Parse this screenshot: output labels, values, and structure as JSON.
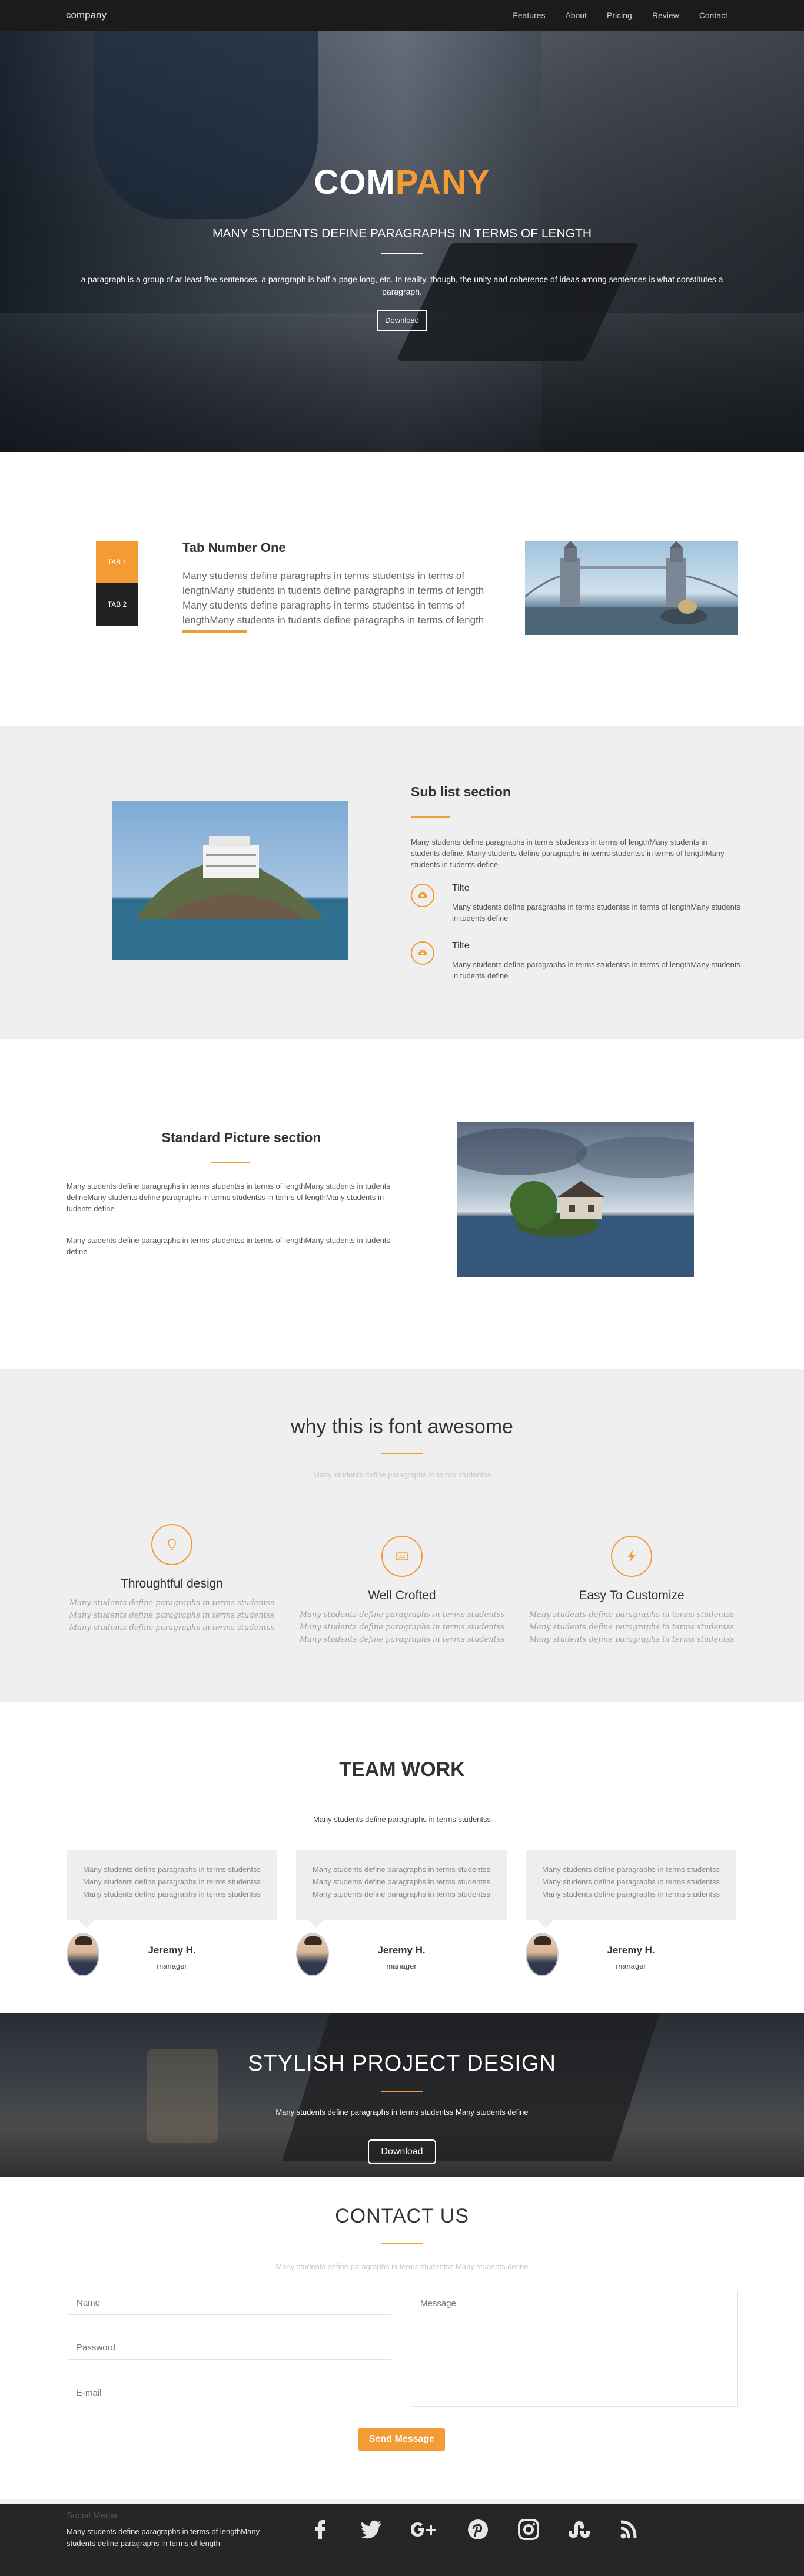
{
  "nav": {
    "brand": "company",
    "links": [
      "Features",
      "About",
      "Pricing",
      "Review",
      "Contact"
    ]
  },
  "hero": {
    "title_white": "COM",
    "title_orange": "PANY",
    "subtitle": "MANY STUDENTS DEFINE PARAGRAPHS IN TERMS OF LENGTH",
    "text": "a paragraph is a group of at least five sentences, a paragraph is half a page long, etc. In reality, though, the unity and coherence of ideas among sentences is what constitutes a paragraph.",
    "button": "Download"
  },
  "tabs": {
    "items": [
      "TAB 1",
      "TAB 2"
    ],
    "title": "Tab Number One",
    "text": "Many students define paragraphs in terms studentss in terms of lengthMany students in tudents define paragraphs in terms of length Many students define paragraphs in terms studentss in terms of lengthMany students in tudents define paragraphs in terms of length"
  },
  "sublist": {
    "title": "Sub list section",
    "text": "Many students define paragraphs in terms studentss in terms of lengthMany students in students define. Many students define paragraphs in terms studentss in terms of lengthMany students in tudents define",
    "items": [
      {
        "title": "Tilte",
        "text": "Many students define paragraphs in terms studentss in terms of lengthMany students in tudents define"
      },
      {
        "title": "Tilte",
        "text": "Many students define paragraphs in terms studentss in terms of lengthMany students in tudents define"
      }
    ]
  },
  "standard": {
    "title": "Standard Picture section",
    "text1": "Many students define paragraphs in terms studentss in terms of lengthMany students in tudents defineMany students define paragraphs in terms studentss in terms of lengthMany students in tudents define",
    "text2": "Many students define paragraphs in terms studentss in terms of lengthMany students in tudents define"
  },
  "features": {
    "title": "why this is font awesome",
    "subtitle": "Many students define paragraphs in terms studentss",
    "cols": [
      {
        "icon": "lightbulb-icon",
        "title": "Throughtful design",
        "text": "Many students define paragraphs in terms studentss Many students define paragraphs in terms studentss Many students define paragraphs in terms studentss"
      },
      {
        "icon": "keyboard-icon",
        "title": "Well Crofted",
        "text": "Many students define paragraphs in terms studentss Many students define paragraphs in terms studentss Many students define paragraphs in terms studentss"
      },
      {
        "icon": "bolt-icon",
        "title": "Easy To Customize",
        "text": "Many students define paragraphs in terms studentss Many students define paragraphs in terms studentss Many students define paragraphs in terms studentss"
      }
    ]
  },
  "team": {
    "title": "TEAM WORK",
    "subtitle": "Many students define paragraphs in terms studentss",
    "members": [
      {
        "text": "Many students define paragraphs in terms studentss Many students define paragraphs in terms studentss Many students define paragraphs in terms studentss",
        "name": "Jeremy H.",
        "role": "manager"
      },
      {
        "text": "Many students define paragraphs in terms studentss Many students define paragraphs in terms studentss Many students define paragraphs in terms studentss",
        "name": "Jeremy H.",
        "role": "manager"
      },
      {
        "text": "Many students define paragraphs in terms studentss Many students define paragraphs in terms studentss Many students define paragraphs in terms studentss",
        "name": "Jeremy H.",
        "role": "manager"
      }
    ]
  },
  "project": {
    "title": "STYLISH PROJECT DESIGN",
    "subtitle": "Many students define paragraphs in terms studentss Many students define",
    "button": "Download"
  },
  "contact": {
    "title": "CONTACT US",
    "subtitle": "Many students define paragraphs in terms studentss Many students define",
    "name_placeholder": "Name",
    "password_placeholder": "Password",
    "email_placeholder": "E-mail",
    "message_placeholder": "Message",
    "button": "Send Message"
  },
  "footer": {
    "title": "Social Media",
    "text": "Many students define paragraphs in terms of lengthMany students define paragraphs in terms of length",
    "socials": [
      "facebook-icon",
      "twitter-icon",
      "google-plus-icon",
      "pinterest-icon",
      "instagram-icon",
      "stumbleupon-icon",
      "rss-icon"
    ]
  },
  "colors": {
    "accent": "#f39b34",
    "nav_bg": "#1b1b1b",
    "section_grey": "#efefef",
    "footer_bg": "#262626"
  }
}
